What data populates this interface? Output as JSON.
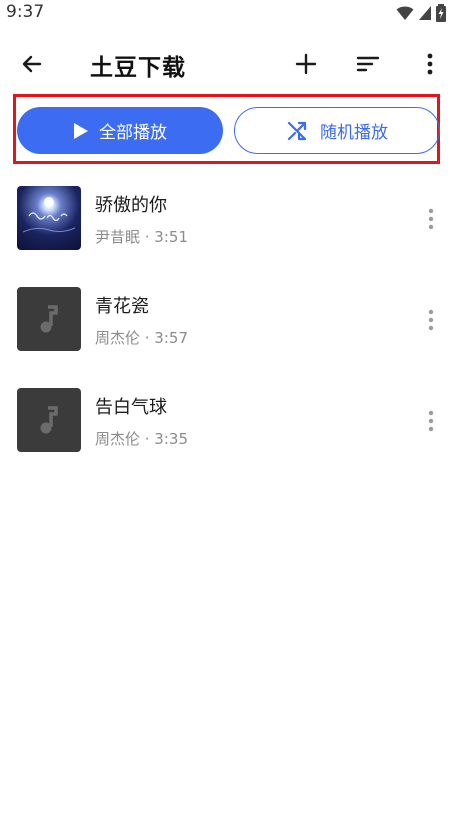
{
  "status_bar": {
    "time": "9:37"
  },
  "app_bar": {
    "title": "土豆下载",
    "back_icon": "arrow-left-icon",
    "add_icon": "plus-icon",
    "sort_icon": "sort-icon",
    "more_icon": "more-vertical-icon"
  },
  "actions": {
    "play_all_label": "全部播放",
    "shuffle_label": "随机播放"
  },
  "songs": [
    {
      "title": "骄傲的你",
      "subtitle": "尹昔眠 · 3:51",
      "cover": "album-art"
    },
    {
      "title": "青花瓷",
      "subtitle": "周杰伦 · 3:57",
      "cover": "music-note-placeholder"
    },
    {
      "title": "告白气球",
      "subtitle": "周杰伦 · 3:35",
      "cover": "music-note-placeholder"
    }
  ],
  "colors": {
    "accent": "#3c6cf2",
    "highlight": "#e0161b",
    "placeholder_bg": "#3b3b3b"
  }
}
